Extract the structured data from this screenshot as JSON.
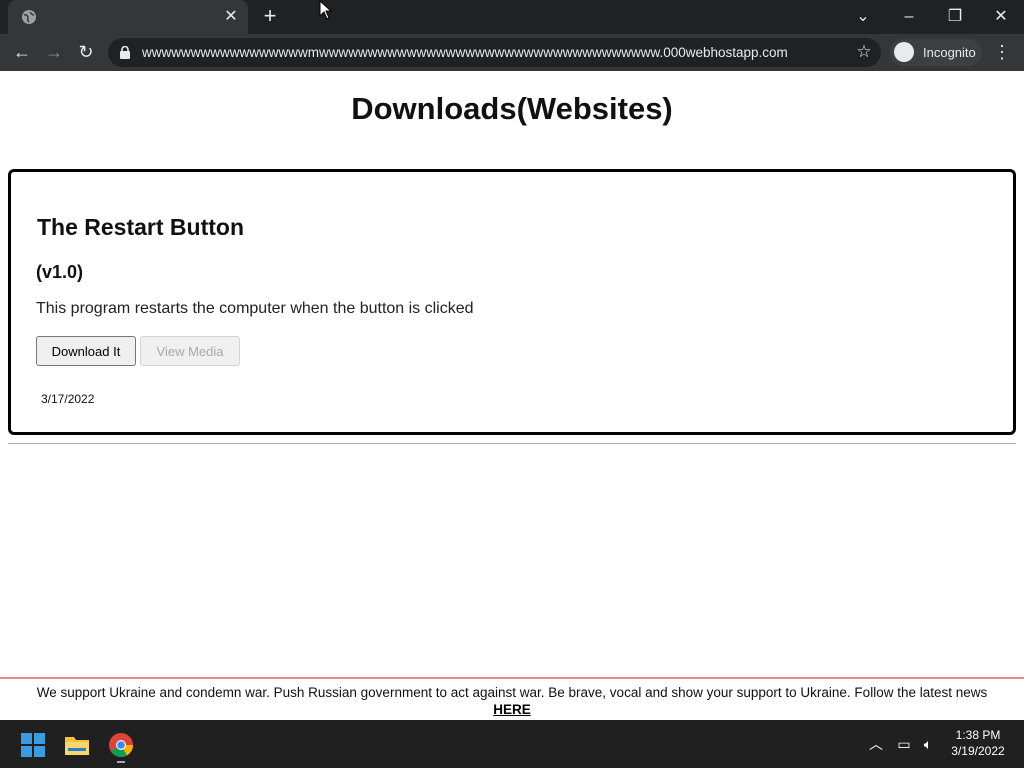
{
  "browser": {
    "new_tab_label": "+",
    "url": "wwwwwwwwwwwwwwwwwmwwwwwwwwwwwwwwwwwwwwwwwwwwwwwwwwwww.000webhostapp.com",
    "incognito_label": "Incognito"
  },
  "page": {
    "title": "Downloads(Websites)",
    "item": {
      "name": "The Restart Button",
      "version": "(v1.0)",
      "description": "This program restarts the computer when the button is clicked",
      "download_label": "Download It",
      "media_label": "View Media",
      "date": "3/17/2022"
    }
  },
  "banner": {
    "text": "We support Ukraine and condemn war. Push Russian government to act against war. Be brave, vocal and show your support to Ukraine. Follow the latest news",
    "link_label": "HERE"
  },
  "taskbar": {
    "time": "1:38 PM",
    "date": "3/19/2022"
  },
  "colors": {
    "browser_dark": "#202124",
    "toolbar": "#35363a",
    "banner_border": "#e88888",
    "taskbar": "#202020"
  }
}
